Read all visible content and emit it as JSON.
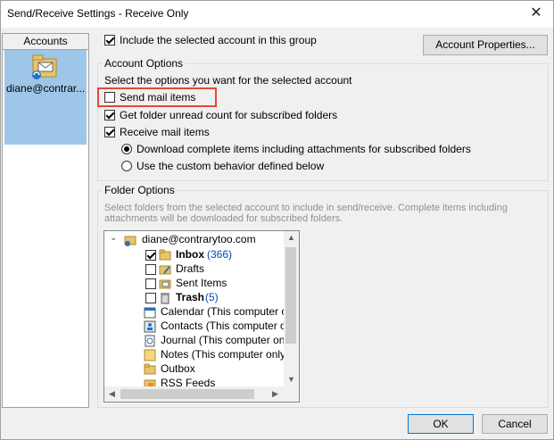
{
  "window": {
    "title": "Send/Receive Settings - Receive Only",
    "close_glyph": "✕"
  },
  "accounts": {
    "header": "Accounts",
    "item_label": "diane@contrar..."
  },
  "include_account": {
    "label": "Include the selected account in this group",
    "checked": true
  },
  "account_properties_button": "Account Properties...",
  "account_options": {
    "title": "Account Options",
    "description": "Select the options you want for the selected account",
    "send_mail": {
      "label": "Send mail items",
      "checked": false
    },
    "folder_unread": {
      "label": "Get folder unread count for subscribed folders",
      "checked": true
    },
    "receive_mail": {
      "label": "Receive mail items",
      "checked": true
    },
    "radio_download": {
      "label": "Download complete items including attachments for subscribed folders",
      "checked": true
    },
    "radio_custom": {
      "label": "Use the custom behavior defined below",
      "checked": false
    }
  },
  "folder_options": {
    "title": "Folder Options",
    "description_line1": "Select folders from the selected account to include in send/receive. Complete items including",
    "description_line2": "attachments will be downloaded for subscribed folders."
  },
  "tree": {
    "root": "diane@contrarytoo.com",
    "inbox": {
      "label": "Inbox",
      "count": "(366)"
    },
    "drafts": "Drafts",
    "sent": "Sent Items",
    "trash": {
      "label": "Trash",
      "count": "(5)"
    },
    "calendar": "Calendar (This computer on",
    "contacts": "Contacts (This computer onl",
    "journal": "Journal (This computer only)",
    "notes": "Notes (This computer only)",
    "outbox": "Outbox",
    "rss": "RSS Feeds"
  },
  "buttons": {
    "ok": "OK",
    "cancel": "Cancel"
  },
  "colors": {
    "highlight_box": "#e8453c",
    "selected_account": "#9ec6e8",
    "count_blue": "#0047ab"
  }
}
